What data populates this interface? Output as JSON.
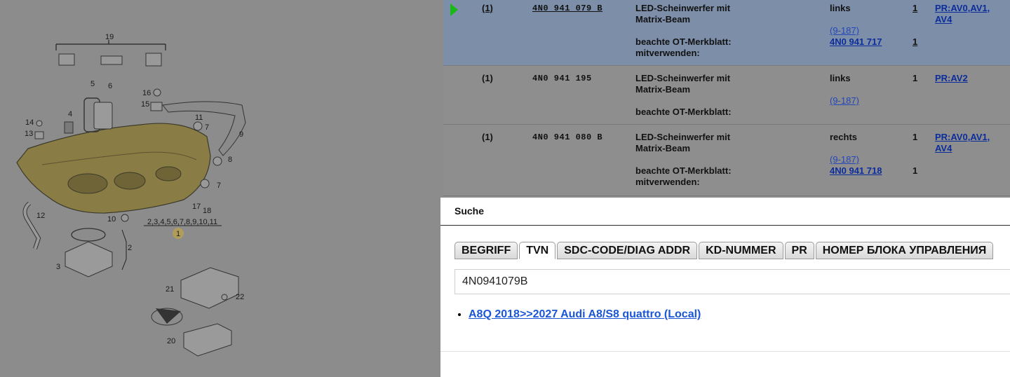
{
  "diagram": {
    "callouts": [
      "19",
      "5",
      "6",
      "16",
      "15",
      "11",
      "7",
      "4",
      "14",
      "13",
      "9",
      "8",
      "7",
      "17",
      "18",
      "10",
      "12",
      "2",
      "3",
      "1",
      "21",
      "22",
      "20"
    ],
    "group_label": "2,3,4,5,6,7,8,9,10,11",
    "marker_label": "1"
  },
  "parts": [
    {
      "pos": "(1)",
      "part_no": "4N0  941  079  B",
      "desc": [
        "LED-Scheinwerfer mit",
        "Matrix-Beam"
      ],
      "note": [
        "beachte OT-Merkblatt:",
        "mitverwenden:"
      ],
      "side": "links",
      "range": "(9-187)",
      "ref_part": "4N0 941 717",
      "qty": "1",
      "ref_qty": "1",
      "pr": [
        "PR:AV0,AV1,",
        "AV4"
      ]
    },
    {
      "pos": "(1)",
      "part_no": "4N0  941  195",
      "desc": [
        "LED-Scheinwerfer mit",
        "Matrix-Beam"
      ],
      "note": [
        "beachte OT-Merkblatt:",
        ""
      ],
      "side": "links",
      "range": "(9-187)",
      "ref_part": "",
      "qty": "1",
      "ref_qty": "",
      "pr": [
        "PR:AV2",
        ""
      ]
    },
    {
      "pos": "(1)",
      "part_no": "4N0  941  080  B",
      "desc": [
        "LED-Scheinwerfer mit",
        "Matrix-Beam"
      ],
      "note": [
        "beachte OT-Merkblatt:",
        "mitverwenden:"
      ],
      "side": "rechts",
      "range": "(9-187)",
      "ref_part": "4N0 941 718",
      "qty": "1",
      "ref_qty": "1",
      "pr": [
        "PR:AV0,AV1,",
        "AV4"
      ]
    }
  ],
  "search": {
    "title": "Suche",
    "tabs": [
      "BEGRIFF",
      "TVN",
      "SDC-CODE/DIAG ADDR",
      "KD-NUMMER",
      "PR",
      "НОМЕР БЛОКА УПРАВЛЕНИЯ"
    ],
    "active_tab": "TVN",
    "query": "4N0941079B",
    "results": [
      "A8Q 2018>>2027 Audi A8/S8 quattro (Local)"
    ]
  },
  "colors": {
    "selected_row": "#7d8ea8",
    "overlay": "#8e8e8e",
    "link": "#1a56d6",
    "arrow": "#17b817"
  }
}
